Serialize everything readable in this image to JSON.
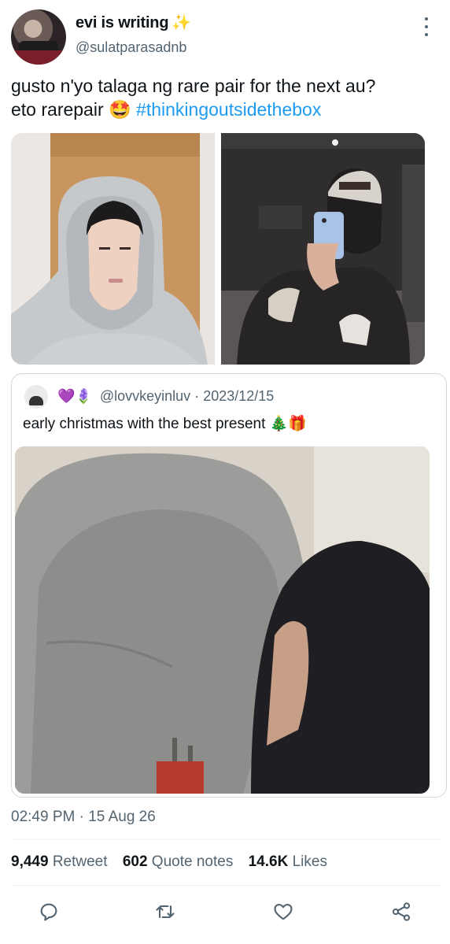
{
  "author": {
    "display_name": "evi is writing",
    "sparkle_emoji": "✨",
    "handle": "@sulatparasadnb"
  },
  "tweet": {
    "line1": "gusto n'yo talaga ng rare pair for the next au?",
    "line2_text": "eto rarepair",
    "line2_emoji": "🤩",
    "hashtag": "#thinkingoutsidethebox"
  },
  "quoted": {
    "emojis": "💜🪻",
    "handle": "@lovvkeyinluv",
    "separator": "·",
    "date": "2023/12/15",
    "text": "early christmas with the best present",
    "text_emojis": "🎄🎁"
  },
  "timestamp": "02:49 PM · 15 Aug 26",
  "stats": {
    "retweets_count": "9,449",
    "retweets_label": "Retweet",
    "quotes_count": "602",
    "quotes_label": "Quote notes",
    "likes_count": "14.6K",
    "likes_label": "Likes"
  },
  "icons": {
    "reply": "reply-icon",
    "retweet": "retweet-icon",
    "like": "heart-icon",
    "share": "share-icon",
    "more": "more-options-icon"
  },
  "colors": {
    "hashtag": "#1d9bf0",
    "secondary_text": "#536471",
    "border": "#cfd9de"
  }
}
